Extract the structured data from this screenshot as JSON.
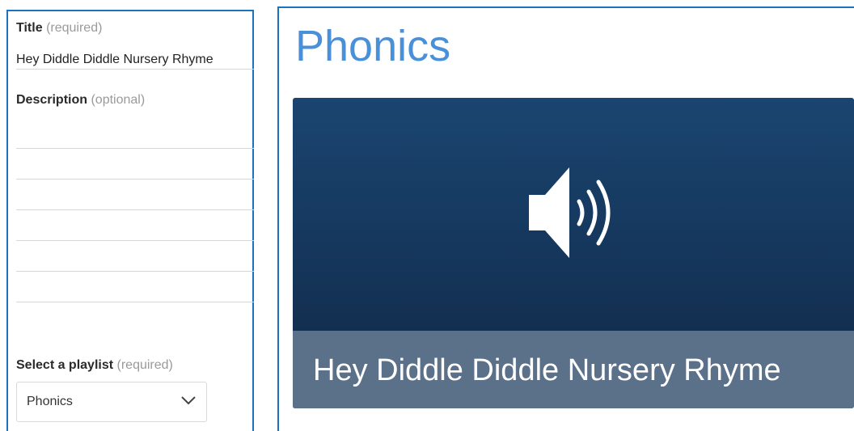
{
  "form": {
    "title_label": "Title",
    "title_hint": "(required)",
    "title_value": "Hey Diddle Diddle Nursery Rhyme",
    "description_label": "Description",
    "description_hint": "(optional)",
    "playlist_label": "Select a playlist",
    "playlist_hint": "(required)",
    "playlist_selected": "Phonics"
  },
  "preview": {
    "playlist_name": "Phonics",
    "card_icon": "speaker-volume-icon",
    "card_title": "Hey Diddle Diddle Nursery Rhyme"
  },
  "colors": {
    "accent_blue": "#1b73c0",
    "title_blue": "#4a90d9",
    "card_top": "#1a4570",
    "card_bottom": "#102744",
    "caption_bar": "#5b7089"
  }
}
